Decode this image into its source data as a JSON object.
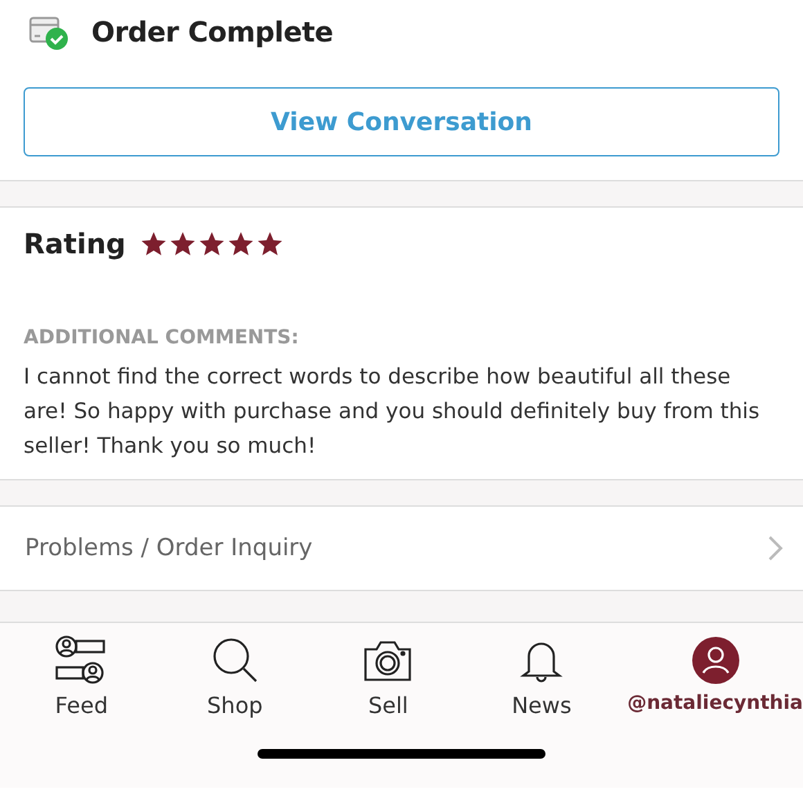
{
  "header": {
    "title": "Order Complete"
  },
  "conversation_button": {
    "label": "View Conversation"
  },
  "rating": {
    "label": "Rating",
    "stars": 5
  },
  "comments": {
    "heading": "ADDITIONAL COMMENTS:",
    "text": "I cannot find the correct words to describe how beautiful all these are! So happy with purchase and you should definitely buy from this seller! Thank you so much!"
  },
  "inquiry": {
    "label": "Problems / Order Inquiry"
  },
  "nav": [
    {
      "kind": "feed",
      "label": "Feed",
      "selected": false
    },
    {
      "kind": "shop",
      "label": "Shop",
      "selected": false
    },
    {
      "kind": "sell",
      "label": "Sell",
      "selected": false
    },
    {
      "kind": "news",
      "label": "News",
      "selected": false
    },
    {
      "kind": "profile",
      "label": "@nataliecynthia",
      "selected": true
    }
  ]
}
